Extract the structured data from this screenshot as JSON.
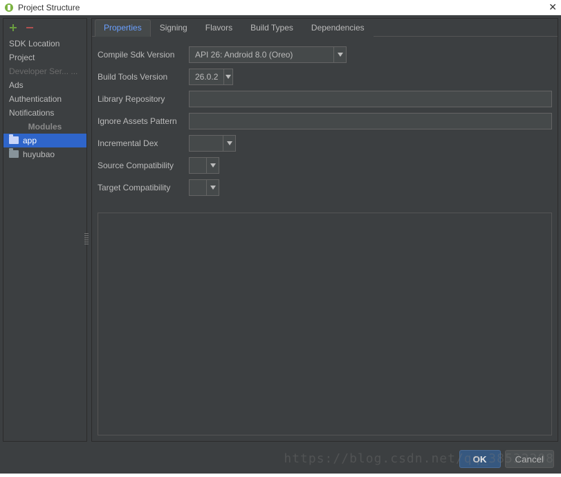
{
  "window": {
    "title": "Project Structure"
  },
  "sidebar": {
    "items": [
      {
        "label": "SDK Location"
      },
      {
        "label": "Project"
      },
      {
        "label": "Developer Ser... ...",
        "dim": true
      },
      {
        "label": "Ads"
      },
      {
        "label": "Authentication"
      },
      {
        "label": "Notifications"
      }
    ],
    "modules_header": "Modules",
    "modules": [
      {
        "label": "app",
        "selected": true
      },
      {
        "label": "huyubao"
      }
    ]
  },
  "tabs": [
    {
      "label": "Properties",
      "active": true
    },
    {
      "label": "Signing"
    },
    {
      "label": "Flavors"
    },
    {
      "label": "Build Types"
    },
    {
      "label": "Dependencies"
    }
  ],
  "form": {
    "compile_sdk": {
      "label": "Compile Sdk Version",
      "value": "API 26: Android 8.0 (Oreo)"
    },
    "build_tools": {
      "label": "Build Tools Version",
      "value": "26.0.2"
    },
    "library_repo": {
      "label": "Library Repository",
      "value": ""
    },
    "ignore_assets": {
      "label": "Ignore Assets Pattern",
      "value": ""
    },
    "incremental_dex": {
      "label": "Incremental Dex",
      "value": ""
    },
    "source_compat": {
      "label": "Source Compatibility",
      "value": ""
    },
    "target_compat": {
      "label": "Target Compatibility",
      "value": ""
    }
  },
  "buttons": {
    "ok": "OK",
    "cancel": "Cancel"
  },
  "watermark": "https://blog.csdn.net/qq_38532208"
}
